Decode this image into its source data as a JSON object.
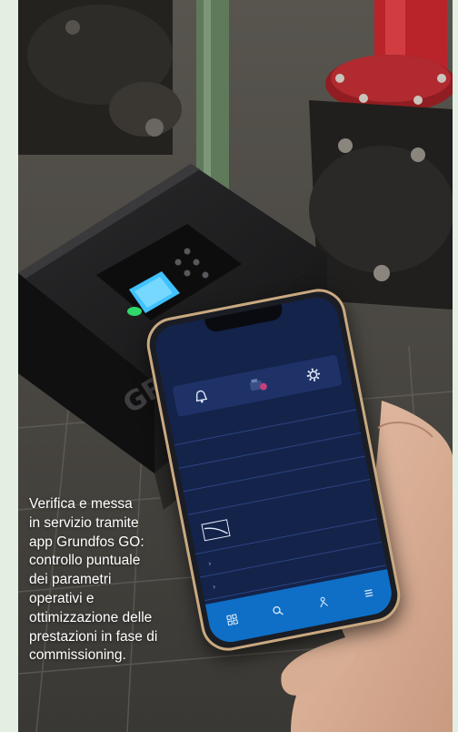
{
  "caption": {
    "lines": [
      "Verifica e messa",
      "in servizio tramite",
      "app Grundfos GO:",
      "controllo puntuale",
      "dei parametri",
      "operativi e",
      "ottimizzazione delle",
      "prestazioni in fase di",
      "commissioning."
    ]
  },
  "colors": {
    "page_background": "#e4efe3",
    "app_background": "#14234a",
    "tab_bar": "#0f6fc6",
    "pump_body": "#1c1c1e",
    "pipe_red": "#b8242a",
    "display_cyan": "#3fc2ff",
    "status_led_green": "#2fd86a"
  },
  "icons": {
    "alarm": "bell-icon",
    "pump": "pump-icon",
    "settings": "gear-icon"
  }
}
